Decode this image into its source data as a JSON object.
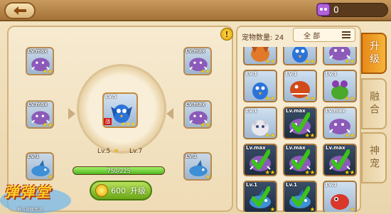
{
  "header": {
    "gems": "0"
  },
  "left": {
    "info": "!",
    "slots": [
      {
        "lv": "Lv.max",
        "stars": "★★",
        "pet": "boar"
      },
      {
        "lv": "Lv.max",
        "stars": "★★",
        "pet": "boar"
      },
      {
        "lv": "Lv.max",
        "stars": "★★",
        "pet": "boar"
      },
      {
        "lv": "Lv.max",
        "stars": "★★",
        "pet": "boar"
      },
      {
        "lv": "Lv.1",
        "stars": "★",
        "pet": "shark"
      },
      {
        "lv": "Lv.1",
        "stars": "★",
        "pet": "shark"
      }
    ],
    "main_pet": {
      "lv": "Lv.5",
      "badge": "战",
      "stars": "★★★",
      "pet": "bird"
    },
    "level_from": "Lv.5",
    "level_to": "Lv.7",
    "exp_text": "750/225",
    "exp_fraction": 1.0,
    "upgrade_cost": "600",
    "upgrade_label": "升级"
  },
  "right": {
    "count_label": "宠物数量: 24",
    "filter_label": "全 部",
    "cards": [
      {
        "lv": "",
        "stars": "★★",
        "pet": "fox",
        "dark": false,
        "checked": false
      },
      {
        "lv": "",
        "stars": "★★",
        "pet": "bird",
        "dark": false,
        "checked": false
      },
      {
        "lv": "",
        "stars": "★★",
        "pet": "boar",
        "dark": false,
        "checked": false
      },
      {
        "lv": "Lv.1",
        "stars": "★★",
        "pet": "bird",
        "dark": false,
        "checked": false
      },
      {
        "lv": "Lv.1",
        "stars": "★★",
        "pet": "dragon",
        "dark": false,
        "checked": false
      },
      {
        "lv": "Lv.1",
        "stars": "★★",
        "pet": "plant",
        "dark": false,
        "checked": false
      },
      {
        "lv": "Lv.1",
        "stars": "★★",
        "pet": "cat",
        "dark": false,
        "checked": false
      },
      {
        "lv": "Lv.max",
        "stars": "★★",
        "pet": "boar",
        "dark": true,
        "checked": true
      },
      {
        "lv": "Lv.max",
        "stars": "★★",
        "pet": "boar",
        "dark": false,
        "checked": false
      },
      {
        "lv": "Lv.max",
        "stars": "★★",
        "pet": "boar",
        "dark": true,
        "checked": true
      },
      {
        "lv": "Lv.max",
        "stars": "★★",
        "pet": "boar",
        "dark": true,
        "checked": true
      },
      {
        "lv": "Lv.max",
        "stars": "★★",
        "pet": "boar",
        "dark": true,
        "checked": true
      },
      {
        "lv": "Lv.1",
        "stars": "★",
        "pet": "shark",
        "dark": true,
        "checked": true
      },
      {
        "lv": "Lv.1",
        "stars": "★",
        "pet": "shark",
        "dark": true,
        "checked": true
      },
      {
        "lv": "Lv.1",
        "stars": "★",
        "pet": "dino",
        "dark": false,
        "checked": false
      }
    ]
  },
  "tabs": [
    {
      "label": "升级",
      "active": true
    },
    {
      "label": "融合",
      "active": false
    },
    {
      "label": "神宠",
      "active": false
    }
  ],
  "logo": {
    "title": "弹弹堂",
    "subtitle": "官方正版手游"
  },
  "colors": {
    "accent": "#e88a18",
    "exp": "#4fb61e",
    "check": "#3cc21a"
  }
}
